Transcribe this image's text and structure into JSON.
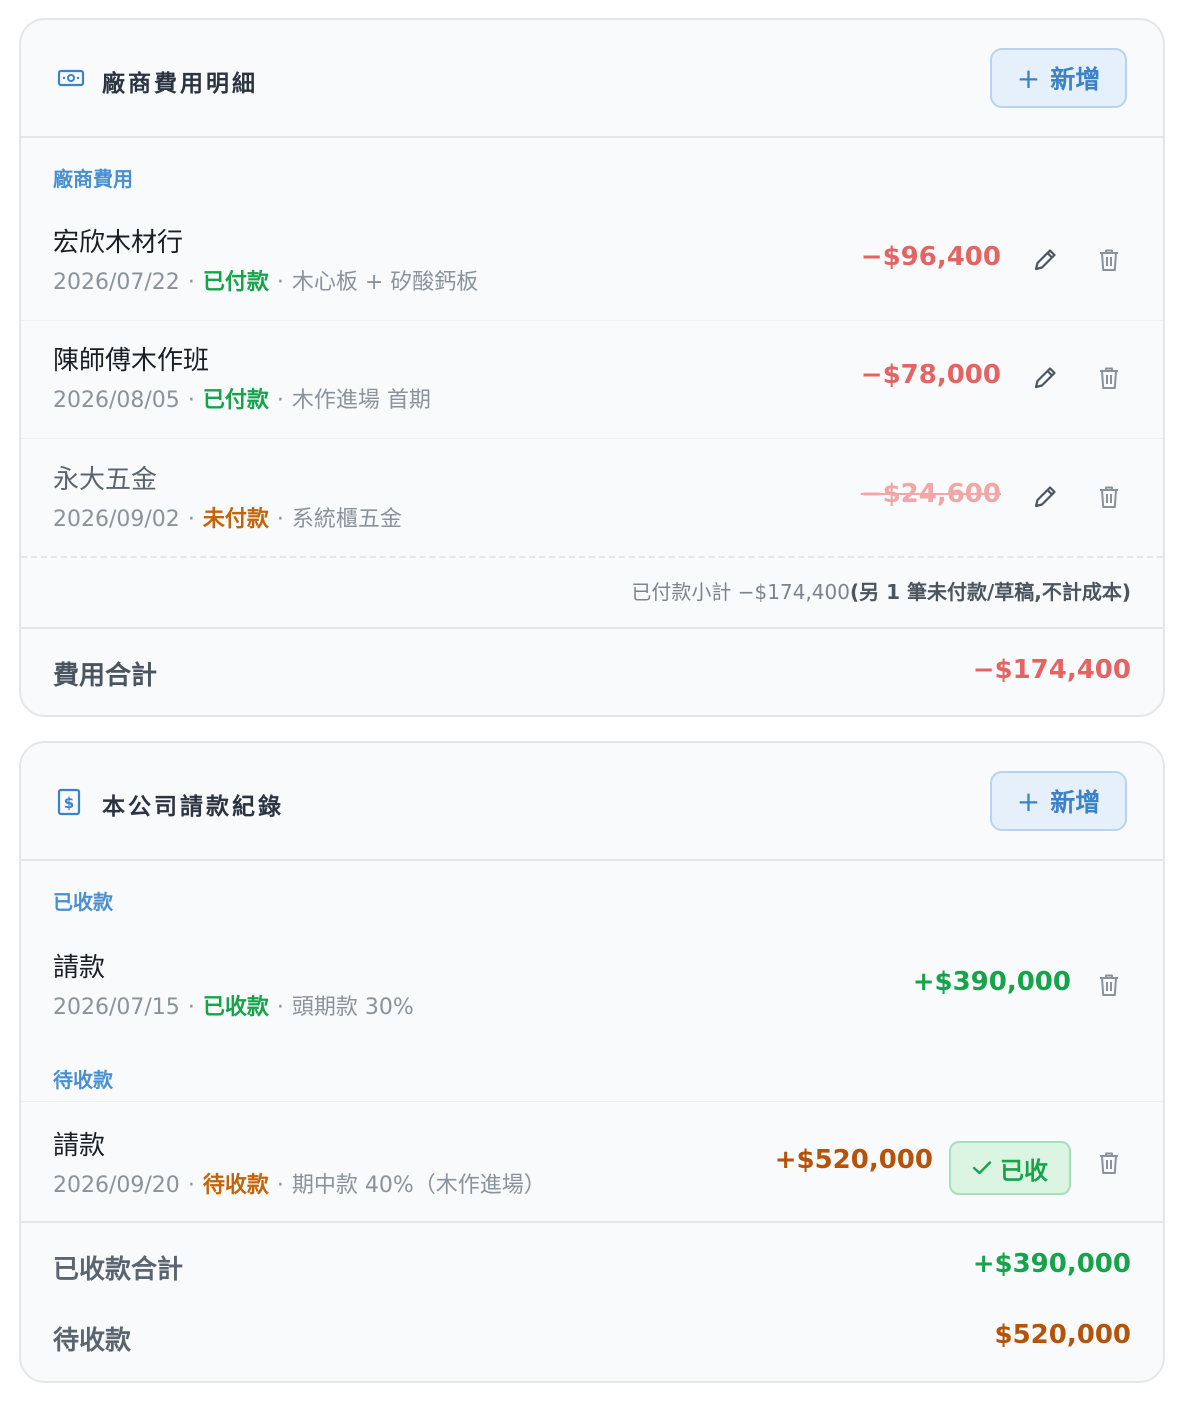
{
  "expenses_card": {
    "title": "廠商費用明細",
    "add_label": "新增",
    "section_label": "廠商費用",
    "items": [
      {
        "name": "宏欣木材行",
        "date": "2026/07/22",
        "status": "已付款",
        "note": "木心板 + 矽酸鈣板",
        "amount": "−$96,400"
      },
      {
        "name": "陳師傅木作班",
        "date": "2026/08/05",
        "status": "已付款",
        "note": "木作進場 首期",
        "amount": "−$78,000"
      },
      {
        "name": "永大五金",
        "date": "2026/09/02",
        "status": "未付款",
        "note": "系統櫃五金",
        "amount": "−$24,600"
      }
    ],
    "subtotal_label": "已付款小計",
    "subtotal_value": "−$174,400",
    "subtotal_note": "(另 1 筆未付款/草稿,不計成本)",
    "total_label": "費用合計",
    "total_value": "−$174,400"
  },
  "invoices_card": {
    "title": "本公司請款紀錄",
    "add_label": "新增",
    "received_section_label": "已收款",
    "pending_section_label": "待收款",
    "received_item": {
      "name": "請款",
      "date": "2026/07/15",
      "status": "已收款",
      "note": "頭期款 30%",
      "amount": "+$390,000"
    },
    "pending_item": {
      "name": "請款",
      "date": "2026/09/20",
      "status": "待收款",
      "note": "期中款 40%（木作進場）",
      "amount": "+$520,000",
      "mark_received_label": "已收"
    },
    "received_total_label": "已收款合計",
    "received_total_value": "+$390,000",
    "pending_total_label": "待收款",
    "pending_total_value": "$520,000"
  },
  "colors": {
    "accent": "#3b82c9",
    "negative": "#e46464",
    "positive": "#16a34a",
    "pending": "#b45309"
  }
}
